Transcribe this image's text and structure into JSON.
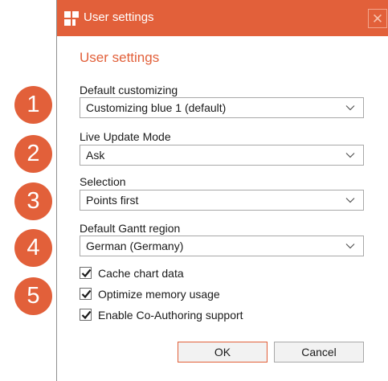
{
  "window": {
    "title": "User settings",
    "accent_color": "#e2603a",
    "close_icon": "close-icon"
  },
  "form": {
    "heading": "User settings",
    "fields": [
      {
        "label": "Default customizing",
        "value": "Customizing blue 1 (default)"
      },
      {
        "label": "Live Update Mode",
        "value": "Ask"
      },
      {
        "label": "Selection",
        "value": "Points first"
      },
      {
        "label": "Default Gantt region",
        "value": "German (Germany)"
      }
    ],
    "checkboxes": [
      {
        "label": "Cache chart data",
        "checked": true
      },
      {
        "label": "Optimize memory usage",
        "checked": true
      },
      {
        "label": "Enable Co-Authoring support",
        "checked": true
      }
    ]
  },
  "buttons": {
    "ok": "OK",
    "cancel": "Cancel"
  },
  "badges": [
    "1",
    "2",
    "3",
    "4",
    "5"
  ]
}
